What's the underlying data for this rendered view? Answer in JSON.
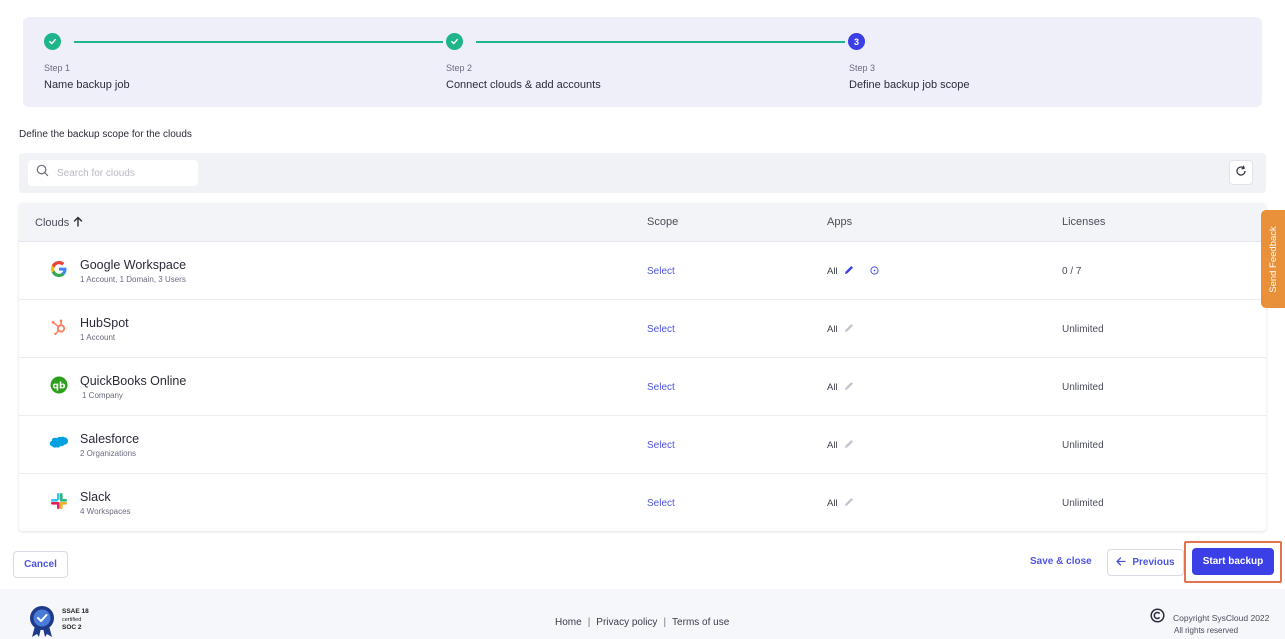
{
  "stepper": {
    "steps": [
      {
        "number": "Step 1",
        "name": "Name backup job",
        "status": "done"
      },
      {
        "number": "Step 2",
        "name": "Connect clouds & add accounts",
        "status": "done"
      },
      {
        "number": "Step 3",
        "name": "Define backup job scope",
        "status": "current",
        "badge": "3"
      }
    ]
  },
  "scope_title": "Define the backup scope for the clouds",
  "search": {
    "placeholder": "Search for clouds",
    "value": ""
  },
  "table": {
    "headers": {
      "clouds": "Clouds",
      "scope": "Scope",
      "apps": "Apps",
      "licenses": "Licenses"
    },
    "rows": [
      {
        "name": "Google Workspace",
        "sub": "1 Account, 1 Domain, 3 Users",
        "scope": "Select",
        "apps": "All",
        "licenses": "0 / 7",
        "logo": "google-logo"
      },
      {
        "name": "HubSpot",
        "sub": "1 Account",
        "scope": "Select",
        "apps": "All",
        "licenses": "Unlimited",
        "logo": "hubspot-logo"
      },
      {
        "name": "QuickBooks Online",
        "sub": "1 Company",
        "scope": "Select",
        "apps": "All",
        "licenses": "Unlimited",
        "logo": "quickbooks-logo"
      },
      {
        "name": "Salesforce",
        "sub": "2 Organizations",
        "scope": "Select",
        "apps": "All",
        "licenses": "Unlimited",
        "logo": "salesforce-logo"
      },
      {
        "name": "Slack",
        "sub": "4 Workspaces",
        "scope": "Select",
        "apps": "All",
        "licenses": "Unlimited",
        "logo": "slack-logo"
      }
    ]
  },
  "feedback": "Send Feedback",
  "actions": {
    "cancel": "Cancel",
    "save_close": "Save & close",
    "previous": "Previous",
    "start_backup": "Start backup"
  },
  "footer": {
    "badge_line1": "SSAE 18",
    "badge_line2": "certified",
    "badge_line3": "SOC 2",
    "links": [
      "Home",
      "Privacy policy",
      "Terms of use"
    ],
    "copyright": "Copyright SysCloud 2022",
    "rights": "All rights reserved"
  },
  "colors": {
    "accent": "#3b3fe6",
    "success": "#1fb58a",
    "feedback": "#e8913a",
    "highlight": "#e5714d"
  }
}
